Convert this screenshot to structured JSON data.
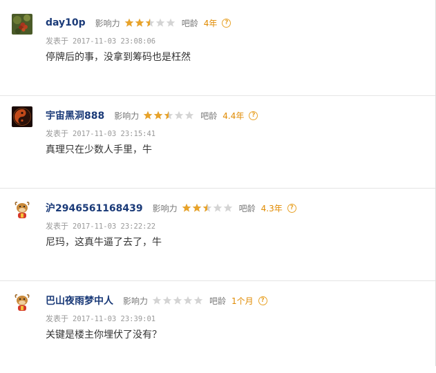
{
  "ui": {
    "influence_label": "影响力",
    "age_label": "吧龄",
    "posted_label": "发表于",
    "help_glyph": "?"
  },
  "colors": {
    "username": "#1a3a78",
    "star_on": "#e8a32a",
    "star_off": "#d4d4d4",
    "age": "#e08a00"
  },
  "comments": [
    {
      "username": "day10p",
      "avatar_icon": "grapes-photo-avatar",
      "influence_stars": 2.5,
      "age": "4年",
      "posted_at": "2017-11-03 23:08:06",
      "text": "停牌后的事，没拿到筹码也是枉然"
    },
    {
      "username": "宇宙黑洞888",
      "avatar_icon": "yin-yang-avatar",
      "influence_stars": 2.5,
      "age": "4.4年",
      "posted_at": "2017-11-03 23:15:41",
      "text": "真理只在少数人手里，牛"
    },
    {
      "username": "沪2946561168439",
      "avatar_icon": "cartoon-bull-avatar",
      "influence_stars": 2.5,
      "age": "4.3年",
      "posted_at": "2017-11-03 23:22:22",
      "text": "尼玛，这真牛逼了去了，牛"
    },
    {
      "username": "巴山夜雨梦中人",
      "avatar_icon": "cartoon-bull-avatar",
      "influence_stars": 0,
      "age": "1个月",
      "posted_at": "2017-11-03 23:39:01",
      "text": "关键是楼主你埋伏了没有？"
    }
  ]
}
